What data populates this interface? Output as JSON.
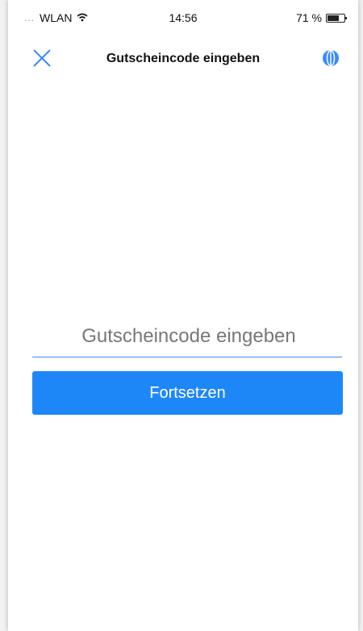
{
  "status_bar": {
    "signal_dots": "...",
    "network": "WLAN",
    "time": "14:56",
    "battery_percent": "71 %",
    "icons": [
      "wifi-icon",
      "battery-icon"
    ]
  },
  "nav": {
    "title": "Gutscheincode eingeben",
    "close_icon": "close-icon",
    "globe_icon": "globe-icon"
  },
  "form": {
    "code_placeholder": "Gutscheincode eingeben",
    "code_value": "",
    "submit_label": "Fortsetzen"
  },
  "colors": {
    "accent": "#1e87f7",
    "underline": "#3b8cf7",
    "icon": "#3b8cf7"
  }
}
